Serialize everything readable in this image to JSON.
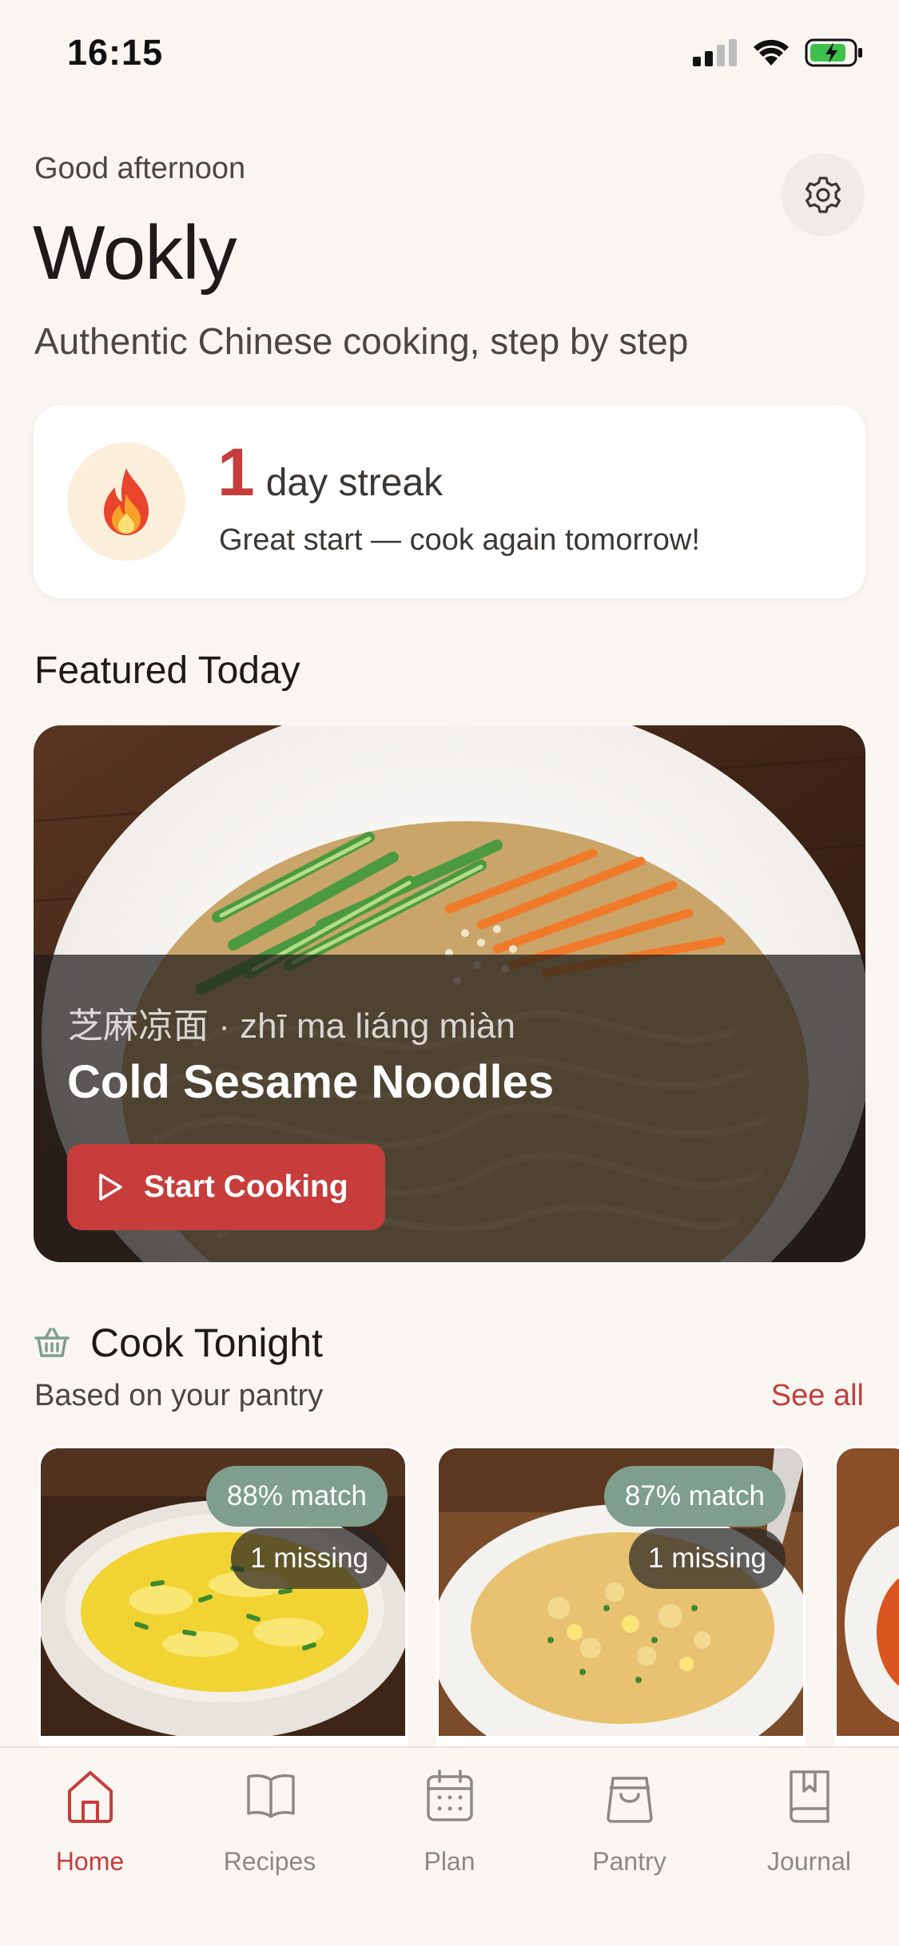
{
  "status_bar": {
    "time": "16:15"
  },
  "header": {
    "greeting": "Good afternoon",
    "title": "Wokly",
    "tagline": "Authentic Chinese cooking, step by step"
  },
  "streak": {
    "count": "1",
    "unit": "day streak",
    "message": "Great start — cook again tomorrow!"
  },
  "featured": {
    "section_title": "Featured Today",
    "subtitle": "芝麻凉面 · zhī ma liáng miàn",
    "name": "Cold Sesame Noodles",
    "button_label": "Start Cooking"
  },
  "cook_tonight": {
    "title": "Cook Tonight",
    "subtitle": "Based on your pantry",
    "see_all": "See all",
    "cards": [
      {
        "match": "88% match",
        "missing": "1 missing"
      },
      {
        "match": "87% match",
        "missing": "1 missing"
      }
    ]
  },
  "tabs": [
    {
      "label": "Home",
      "icon": "home-icon",
      "active": true
    },
    {
      "label": "Recipes",
      "icon": "book-icon",
      "active": false
    },
    {
      "label": "Plan",
      "icon": "calendar-icon",
      "active": false
    },
    {
      "label": "Pantry",
      "icon": "bag-icon",
      "active": false
    },
    {
      "label": "Journal",
      "icon": "journal-icon",
      "active": false
    }
  ],
  "colors": {
    "accent": "#c63d3c",
    "match_badge": "#7f9e8d",
    "background": "#f9f6f2"
  }
}
